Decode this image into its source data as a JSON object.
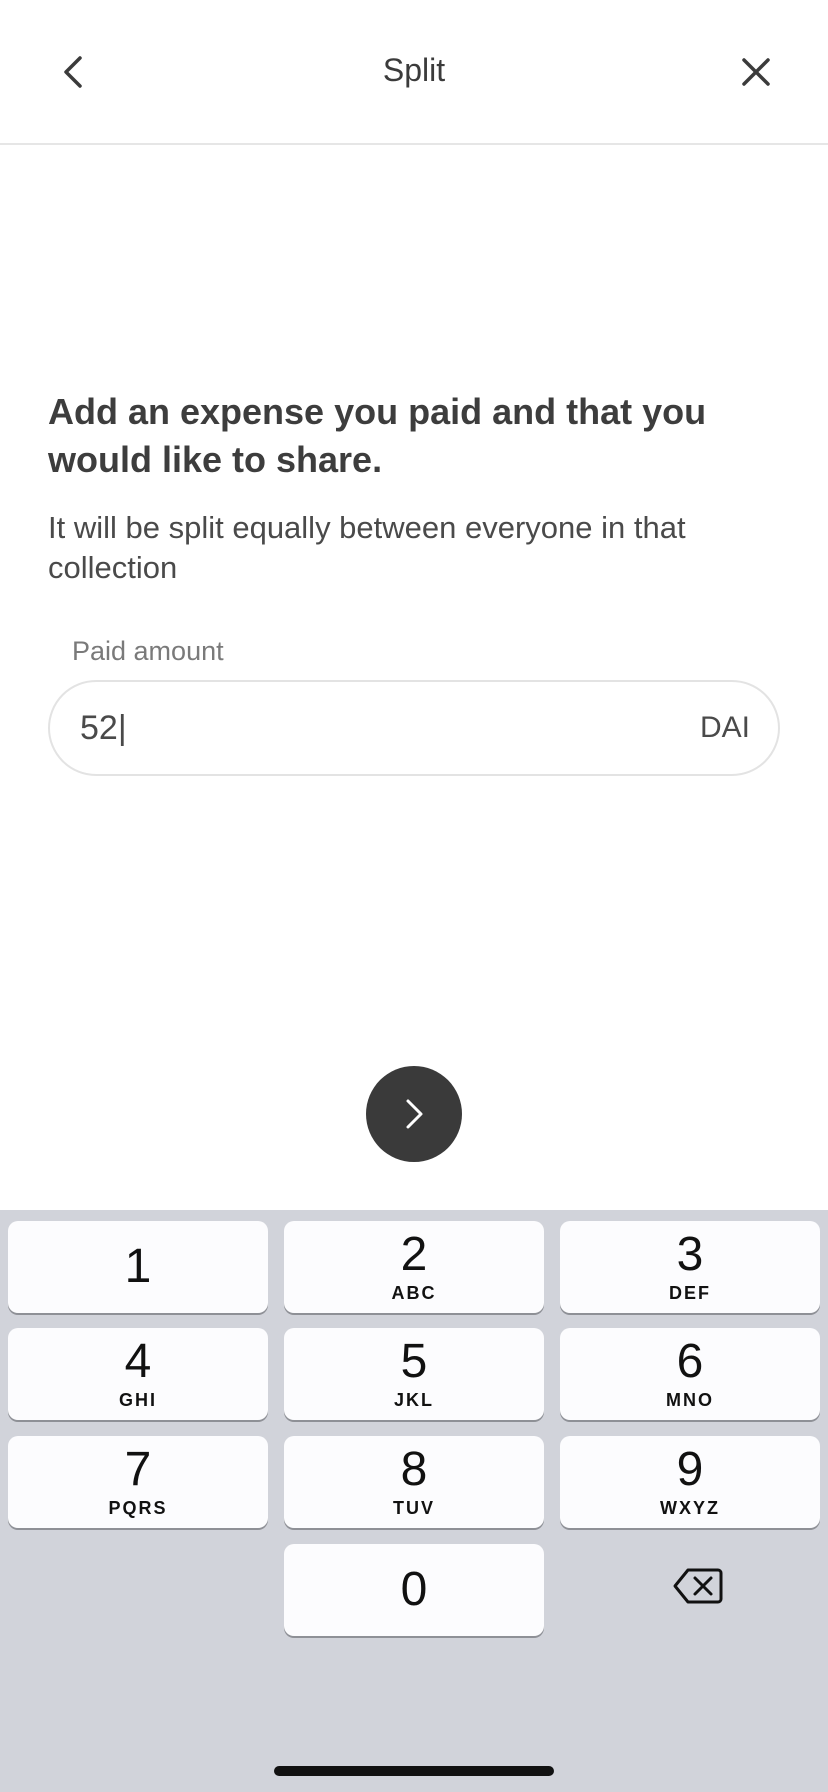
{
  "header": {
    "title": "Split",
    "back_icon": "chevron-left-icon",
    "close_icon": "close-icon"
  },
  "content": {
    "heading": "Add an expense you paid and that you would like to share.",
    "subtext": "It will be split equally between everyone in that collection",
    "amount_label": "Paid amount",
    "amount_value": "52|",
    "currency": "DAI"
  },
  "next_button": {
    "icon": "chevron-right-icon"
  },
  "keypad": {
    "keys": [
      {
        "num": "1",
        "letters": ""
      },
      {
        "num": "2",
        "letters": "ABC"
      },
      {
        "num": "3",
        "letters": "DEF"
      },
      {
        "num": "4",
        "letters": "GHI"
      },
      {
        "num": "5",
        "letters": "JKL"
      },
      {
        "num": "6",
        "letters": "MNO"
      },
      {
        "num": "7",
        "letters": "PQRS"
      },
      {
        "num": "8",
        "letters": "TUV"
      },
      {
        "num": "9",
        "letters": "WXYZ"
      },
      {
        "num": "0",
        "letters": ""
      }
    ],
    "delete_icon": "backspace-icon"
  },
  "colors": {
    "button_dark": "#3a3a3a",
    "keypad_bg": "#d1d3da",
    "key_bg": "#fcfcfe"
  }
}
